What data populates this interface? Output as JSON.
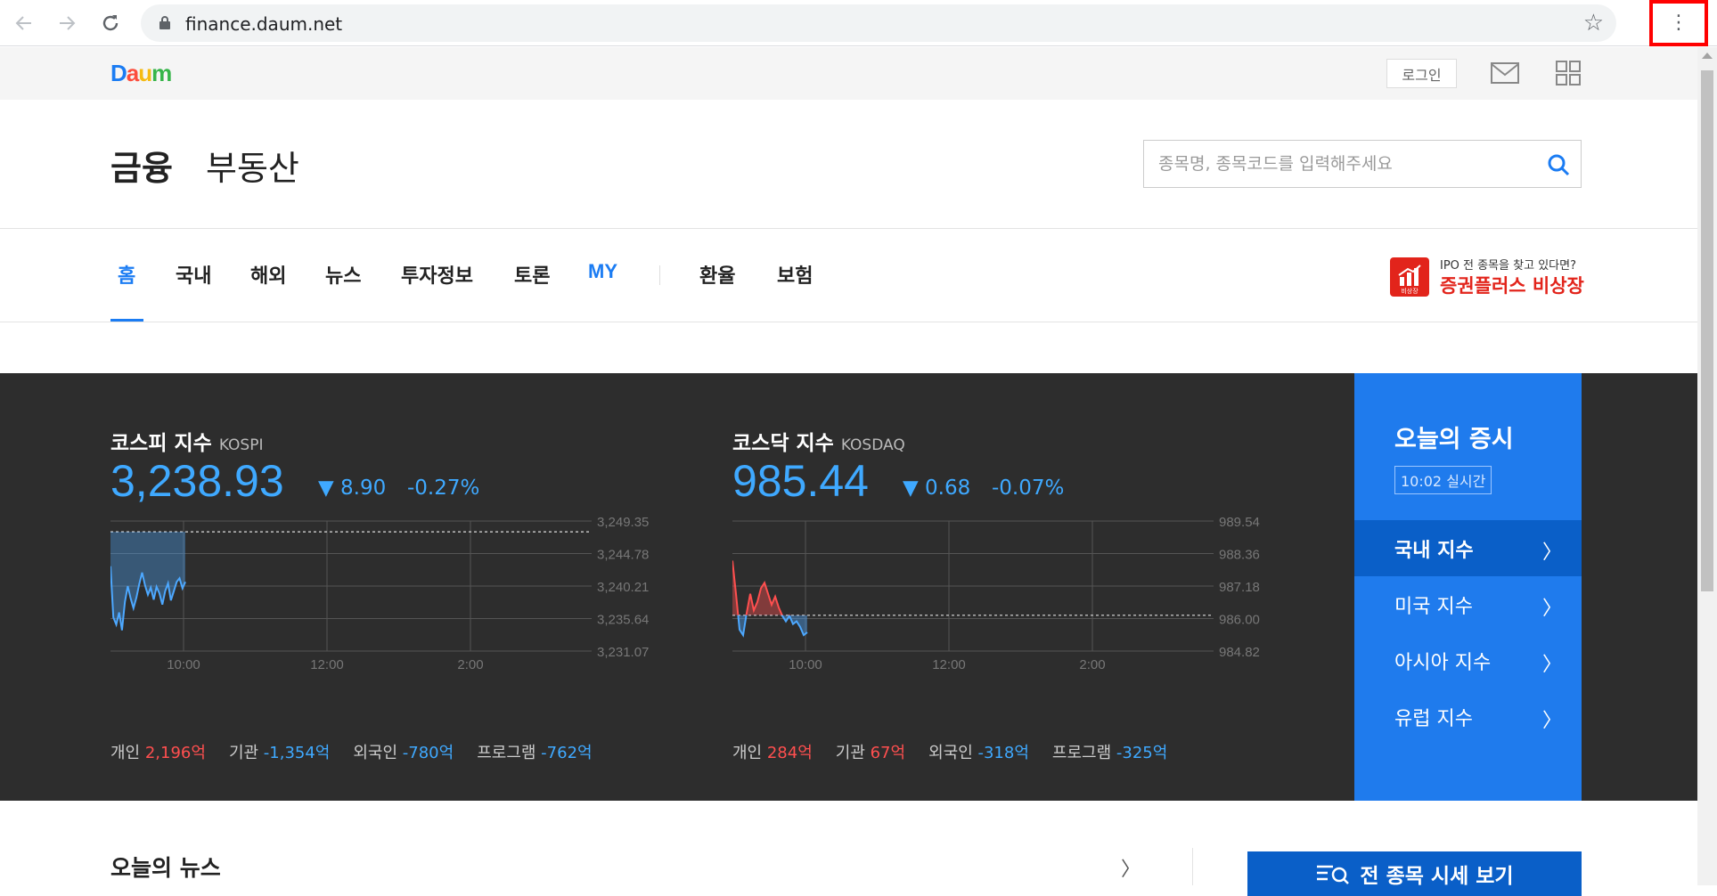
{
  "browser": {
    "url": "finance.daum.net",
    "back_icon": "back-arrow-icon",
    "forward_icon": "forward-arrow-icon",
    "reload_icon": "reload-icon",
    "menu_icon": "vertical-dots-icon",
    "highlight_color": "#ff0000"
  },
  "topbar": {
    "logo_letters": [
      "D",
      "a",
      "u",
      "m"
    ],
    "logo_colors": [
      "#1b7cf3",
      "#fc4d3d",
      "#f5bb14",
      "#37b54a"
    ],
    "login_label": "로그인"
  },
  "header": {
    "finance_label": "금융",
    "realestate_label": "부동산",
    "search_placeholder": "종목명, 종목코드를 입력해주세요"
  },
  "nav": {
    "items": [
      {
        "label": "홈",
        "active": true
      },
      {
        "label": "국내"
      },
      {
        "label": "해외"
      },
      {
        "label": "뉴스"
      },
      {
        "label": "투자정보"
      },
      {
        "label": "토론"
      },
      {
        "label": "MY"
      },
      {
        "label": "환율"
      },
      {
        "label": "보험"
      }
    ],
    "accent_color": "#1b7cf3"
  },
  "ad": {
    "small_text": "IPO 전 종목을 찾고 있다면?",
    "big_text": "증권플러스 비상장",
    "logo_text": "비상장"
  },
  "market": {
    "kospi": {
      "name": "코스피 지수",
      "code": "KOSPI",
      "value": "3,238.93",
      "change": "▼ 8.90",
      "change_pct": "-0.27%",
      "chart_data": {
        "type": "line",
        "x_ticks": [
          "10:00",
          "12:00",
          "2:00"
        ],
        "y_ticks": [
          "3,249.35",
          "3,244.78",
          "3,240.21",
          "3,235.64",
          "3,231.07"
        ],
        "ylim": [
          3231.07,
          3249.35
        ],
        "baseline": 3247.83,
        "values": [
          3243.0,
          3235.8,
          3234.8,
          3236.5,
          3234.0,
          3238.0,
          3240.2,
          3238.5,
          3237.1,
          3238.6,
          3240.5,
          3242.1,
          3240.3,
          3239.0,
          3240.0,
          3238.3,
          3240.1,
          3239.2,
          3237.6,
          3239.5,
          3240.6,
          3238.2,
          3239.5,
          3240.8,
          3241.3,
          3239.9,
          3240.8
        ],
        "line_color": "#4da8ff"
      },
      "investors": [
        {
          "label": "개인",
          "value": "2,196",
          "unit": "억",
          "sign": "pos"
        },
        {
          "label": "기관",
          "value": "-1,354",
          "unit": "억",
          "sign": "neg"
        },
        {
          "label": "외국인",
          "value": "-780",
          "unit": "억",
          "sign": "neg"
        },
        {
          "label": "프로그램",
          "value": "-762",
          "unit": "억",
          "sign": "neg"
        }
      ]
    },
    "kosdaq": {
      "name": "코스닥 지수",
      "code": "KOSDAQ",
      "value": "985.44",
      "change": "▼ 0.68",
      "change_pct": "-0.07%",
      "chart_data": {
        "type": "line",
        "x_ticks": [
          "10:00",
          "12:00",
          "2:00"
        ],
        "y_ticks": [
          "989.54",
          "988.36",
          "987.18",
          "986.00",
          "984.82"
        ],
        "ylim": [
          984.82,
          989.54
        ],
        "baseline": 986.12,
        "values": [
          988.1,
          986.9,
          985.6,
          985.4,
          986.2,
          986.9,
          986.3,
          986.6,
          987.1,
          987.3,
          986.9,
          986.5,
          986.8,
          986.4,
          986.1,
          985.9,
          986.1,
          985.8,
          985.9,
          985.7,
          985.4,
          985.5
        ],
        "up_color": "#ff4f4f",
        "down_color": "#4da8ff"
      },
      "investors": [
        {
          "label": "개인",
          "value": "284",
          "unit": "억",
          "sign": "pos"
        },
        {
          "label": "기관",
          "value": "67",
          "unit": "억",
          "sign": "pos"
        },
        {
          "label": "외국인",
          "value": "-318",
          "unit": "억",
          "sign": "neg"
        },
        {
          "label": "프로그램",
          "value": "-325",
          "unit": "억",
          "sign": "neg"
        }
      ]
    }
  },
  "today": {
    "title": "오늘의 증시",
    "time": "10:02 실시간",
    "items": [
      {
        "label": "국내 지수",
        "active": true
      },
      {
        "label": "미국 지수"
      },
      {
        "label": "아시아 지수"
      },
      {
        "label": "유럽 지수"
      }
    ]
  },
  "bottom": {
    "news_title": "오늘의 뉴스",
    "all_stocks_label": "전 종목 시세 보기"
  }
}
